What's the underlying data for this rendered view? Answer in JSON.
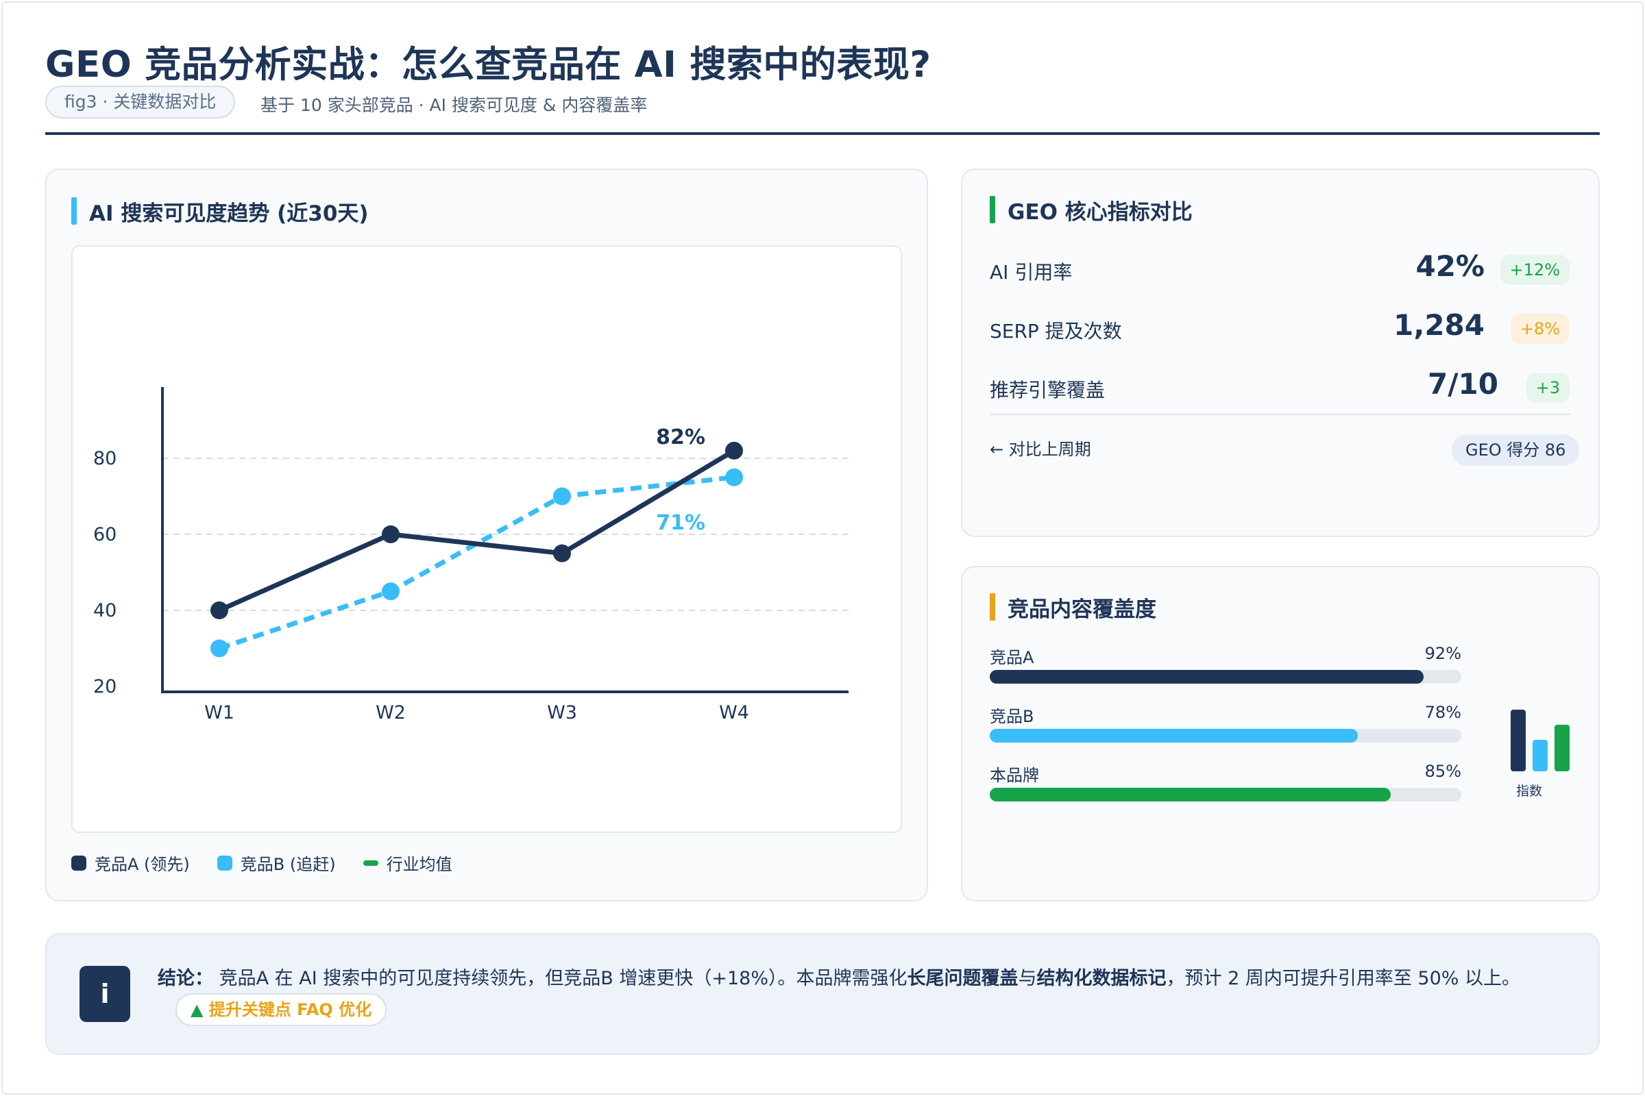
{
  "header": {
    "title": "GEO 竞品分析实战：怎么查竞品在 AI 搜索中的表现?",
    "fig_label": "fig3 · 关键数据对比",
    "subtitle": "基于 10 家头部竞品 · AI 搜索可见度 & 内容覆盖率"
  },
  "trend_card": {
    "title": "AI 搜索可见度趋势 (近30天)",
    "accent": "#38bdf8",
    "legend": [
      {
        "label": "竞品A (领先)",
        "color": "#1e3557",
        "shape": "dot"
      },
      {
        "label": "竞品B (追赶)",
        "color": "#38bdf8",
        "shape": "dot"
      },
      {
        "label": "行业均值",
        "color": "#16a34a",
        "shape": "dash"
      }
    ]
  },
  "chart_data": {
    "type": "line",
    "categories": [
      "W1",
      "W2",
      "W3",
      "W4"
    ],
    "y_ticks": [
      20,
      40,
      60,
      80
    ],
    "ylim": [
      20,
      100
    ],
    "grid": "horizontal dashed",
    "series": [
      {
        "name": "竞品A (领先)",
        "color": "#1e3557",
        "style": "solid",
        "values": [
          40,
          60,
          55,
          82
        ],
        "end_label": "82%"
      },
      {
        "name": "竞品B (追赶)",
        "color": "#38bdf8",
        "style": "dashed",
        "values": [
          30,
          45,
          70,
          75
        ],
        "end_label": "71%"
      }
    ]
  },
  "metrics_card": {
    "title": "GEO 核心指标对比",
    "accent": "#16a34a",
    "rows": [
      {
        "label": "AI 引用率",
        "value": "42%",
        "delta": "+12%",
        "delta_color": "#16a34a",
        "delta_bg": "#e7f6ec"
      },
      {
        "label": "SERP 提及次数",
        "value": "1,284",
        "delta": "+8%",
        "delta_color": "#e8a317",
        "delta_bg": "#fdf1de"
      },
      {
        "label": "推荐引擎覆盖",
        "value": "7/10",
        "delta": "+3",
        "delta_color": "#16a34a",
        "delta_bg": "#e7f6ec"
      }
    ],
    "compare_link": "← 对比上周期",
    "score": "GEO 得分 86"
  },
  "coverage_card": {
    "title": "竞品内容覆盖度",
    "accent": "#e8a317",
    "items": [
      {
        "label": "竞品A",
        "pct_text": "92%",
        "value": 0.92,
        "color": "#1e3557"
      },
      {
        "label": "竞品B",
        "pct_text": "78%",
        "value": 0.78,
        "color": "#38bdf8"
      },
      {
        "label": "本品牌",
        "pct_text": "85%",
        "value": 0.85,
        "color": "#16a34a"
      }
    ],
    "mini_label": "指数"
  },
  "conclusion": {
    "icon": "i",
    "lead": "结论：",
    "text_1": "竞品A 在 AI 搜索中的可见度持续领先，但竞品B 增速更快（+18%）。本品牌需强化",
    "bold_1": "长尾问题覆盖",
    "text_2": "与",
    "bold_2": "结构化数据标记",
    "text_3": "，预计 2 周内可提升引用率至 50% 以上。",
    "cta_icon": "▲",
    "cta_label": "提升关键点 FAQ 优化"
  }
}
